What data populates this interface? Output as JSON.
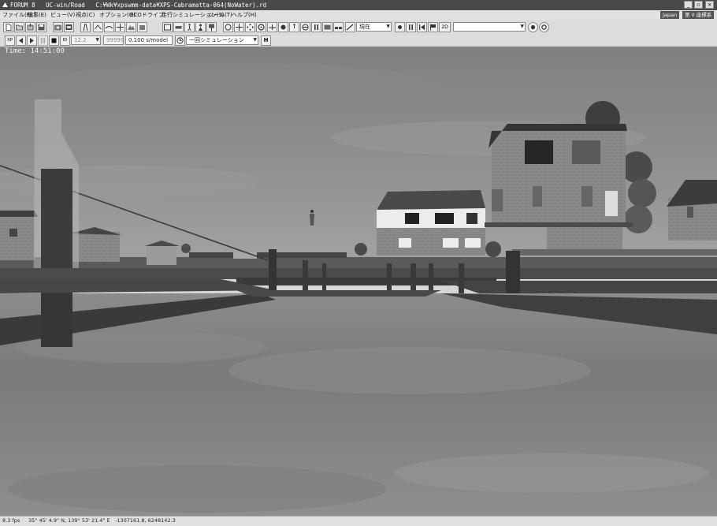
{
  "window": {
    "brand": "FORUM 8",
    "app": "UC-win/Road",
    "path": "C:¥Wk¥xpswmm-data¥XPS-Cabramatta-064(NoWater).rd"
  },
  "menu": [
    "ファイル(F)",
    "編集(E)",
    "ビュー(V)",
    "視点(C)",
    "オプション(O)",
    "ECOドライブ",
    "走行シミュレーション(S)",
    "ツール(T)",
    "ヘルプ(H)"
  ],
  "locale_tag": "Japan",
  "coord_tag": "第 0 座標系",
  "toolbar": {
    "viewpoint_select": "現在",
    "search_select": ""
  },
  "playback": {
    "speed_value": "12.2",
    "frames_value": "99999.",
    "step_value": "0.100 s/model",
    "mode_select": "一回シミュレーション"
  },
  "overlay": {
    "time": "Time: 14:51:00"
  },
  "status": {
    "fps": "8.3 fps",
    "coords": "35° 45' 4.9\" N, 139° 53' 21.4\" E",
    "xy": "-1307161.8, 6248142.3"
  }
}
